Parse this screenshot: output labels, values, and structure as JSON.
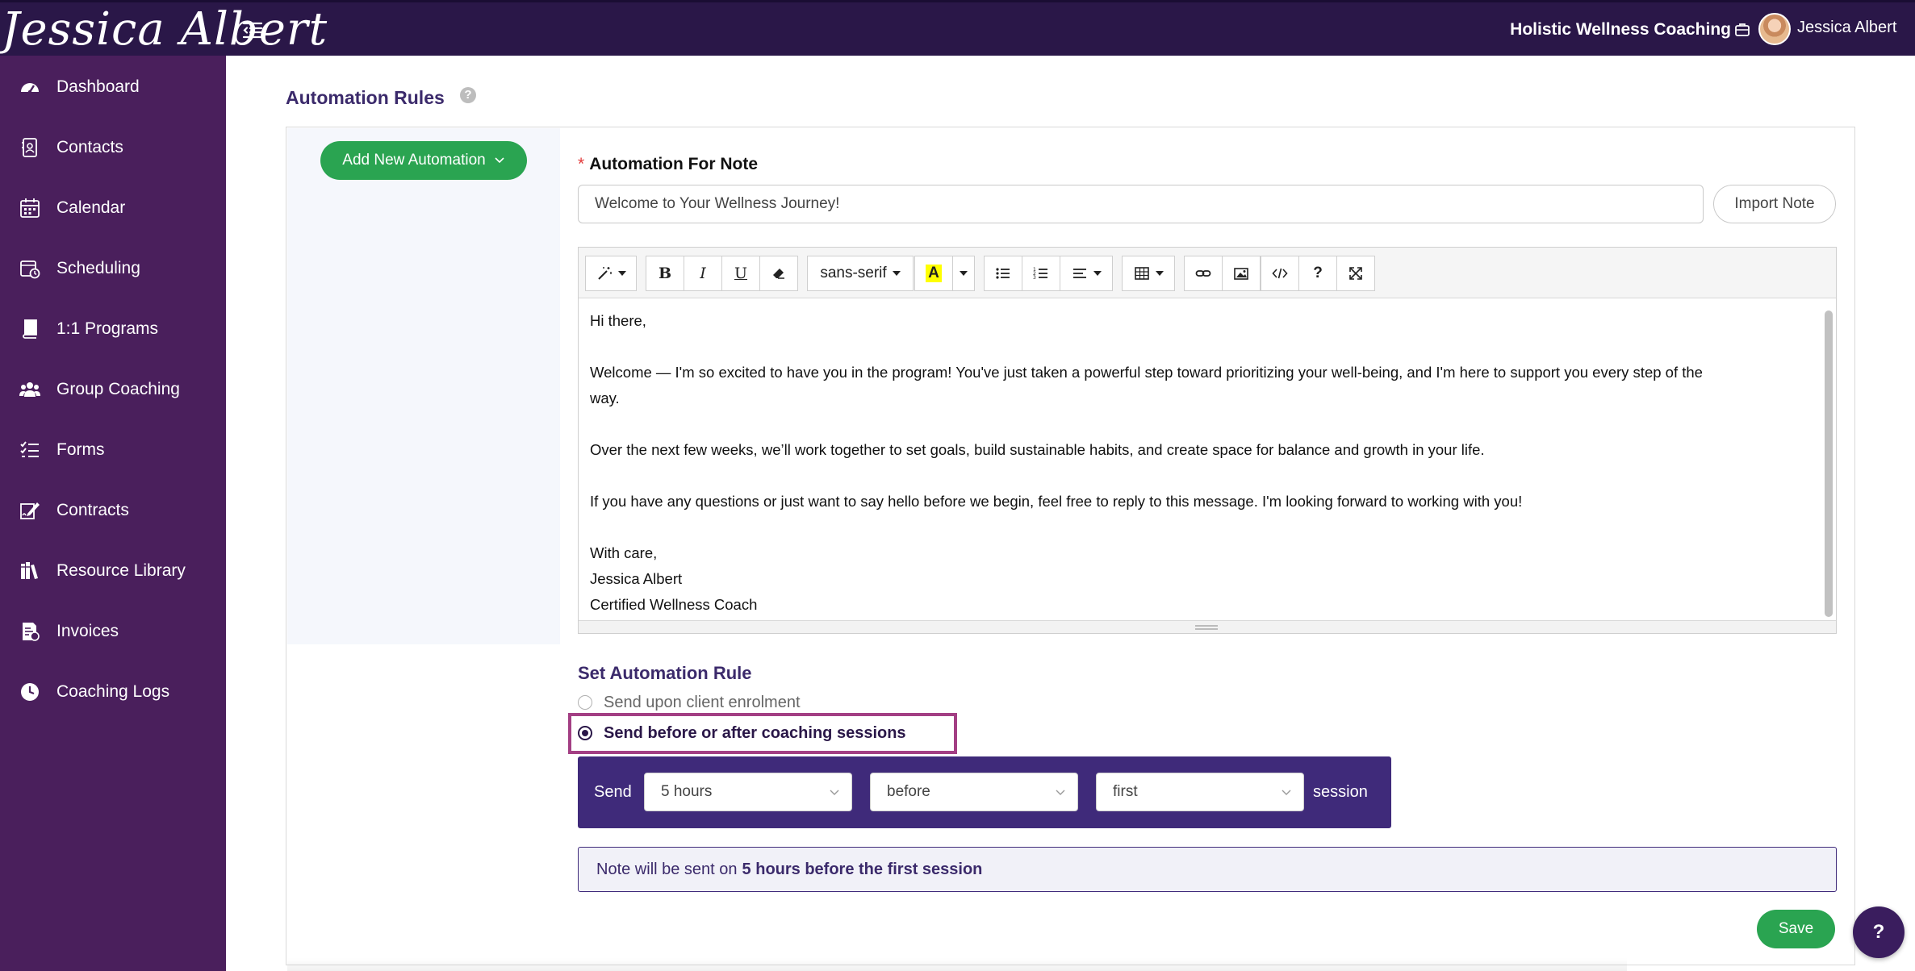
{
  "header": {
    "logo_text": "Jessica Albert",
    "org_name": "Holistic Wellness Coaching",
    "user_name": "Jessica Albert"
  },
  "sidebar": {
    "items": [
      {
        "label": "Dashboard",
        "icon": "dashboard-icon"
      },
      {
        "label": "Contacts",
        "icon": "contacts-icon"
      },
      {
        "label": "Calendar",
        "icon": "calendar-icon"
      },
      {
        "label": "Scheduling",
        "icon": "scheduling-icon"
      },
      {
        "label": "1:1 Programs",
        "icon": "book-icon"
      },
      {
        "label": "Group Coaching",
        "icon": "users-icon"
      },
      {
        "label": "Forms",
        "icon": "list-check-icon"
      },
      {
        "label": "Contracts",
        "icon": "signature-icon"
      },
      {
        "label": "Resource Library",
        "icon": "library-icon"
      },
      {
        "label": "Invoices",
        "icon": "invoice-icon"
      },
      {
        "label": "Coaching Logs",
        "icon": "clock-icon"
      }
    ]
  },
  "main": {
    "title": "Automation Rules",
    "help_glyph": "?",
    "add_button": "Add New Automation",
    "note_field": {
      "label": "Automation For Note",
      "required_mark": "*",
      "value": "Welcome to Your Wellness Journey!"
    },
    "import_button": "Import Note",
    "toolbar": {
      "font_family": "sans-serif",
      "bold": "B",
      "italic": "I",
      "underline": "U",
      "font_color_glyph": "A",
      "help_glyph": "?"
    },
    "editor": {
      "greeting": "Hi there,",
      "para1": "Welcome — I'm so excited to have you in the program! You've just taken a powerful step toward prioritizing your well-being, and I'm here to support you every step of the",
      "para1_cont": "way.",
      "para2": "Over the next few weeks, we’ll work together to set goals, build sustainable habits, and create space for balance and growth in your life.",
      "para3": "If you have any questions or just want to say hello before we begin, feel free to reply to this message. I'm looking forward to working with you!",
      "closing": "With care,",
      "signature_name": "Jessica Albert",
      "signature_title": "Certified Wellness Coach"
    },
    "rule": {
      "title": "Set Automation Rule",
      "option_enrolment": "Send upon client enrolment",
      "option_sessions": "Send before or after coaching sessions",
      "selected": "option_sessions",
      "send_label": "Send",
      "time_select": "5 hours",
      "direction_select": "before",
      "which_select": "first",
      "session_label": "session",
      "info_prefix": "Note will be sent on",
      "info_value": "5 hours before the first session"
    },
    "save_button": "Save",
    "help_fab": "?"
  },
  "colors": {
    "topbar": "#2a1748",
    "sidebar": "#4a1f5c",
    "accent_green": "#2aa451",
    "accent_purple": "#3f2a7a",
    "highlight": "#a33f84"
  }
}
